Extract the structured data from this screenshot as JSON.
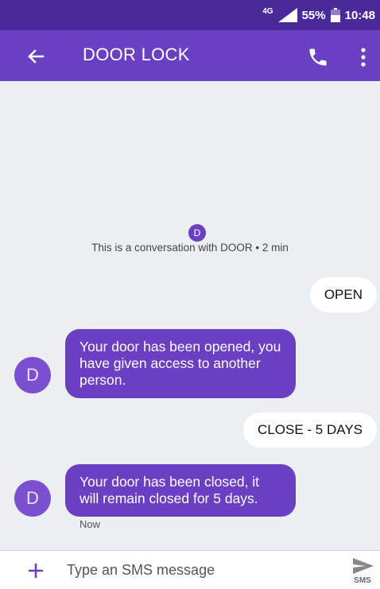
{
  "status_bar": {
    "network": "4G",
    "battery": "55%",
    "time": "10:48"
  },
  "app_bar": {
    "title": "DOOR LOCK"
  },
  "conversation": {
    "intro_avatar_letter": "D",
    "intro_text": "This is a conversation with DOOR • 2 min",
    "messages": [
      {
        "direction": "outgoing",
        "text": "OPEN"
      },
      {
        "direction": "incoming",
        "avatar": "D",
        "text": "Your door has been opened, you have given access to another person."
      },
      {
        "direction": "outgoing",
        "text": "CLOSE - 5 DAYS"
      },
      {
        "direction": "incoming",
        "avatar": "D",
        "text": "Your door has been closed, it will remain closed for 5 days.",
        "time": "Now"
      }
    ]
  },
  "compose": {
    "placeholder": "Type an SMS message",
    "send_label": "SMS"
  },
  "colors": {
    "status_bar": "#4a2a9a",
    "app_bar": "#6a3fc2",
    "incoming_bubble": "#6a3fc2",
    "background": "#eceff1"
  }
}
